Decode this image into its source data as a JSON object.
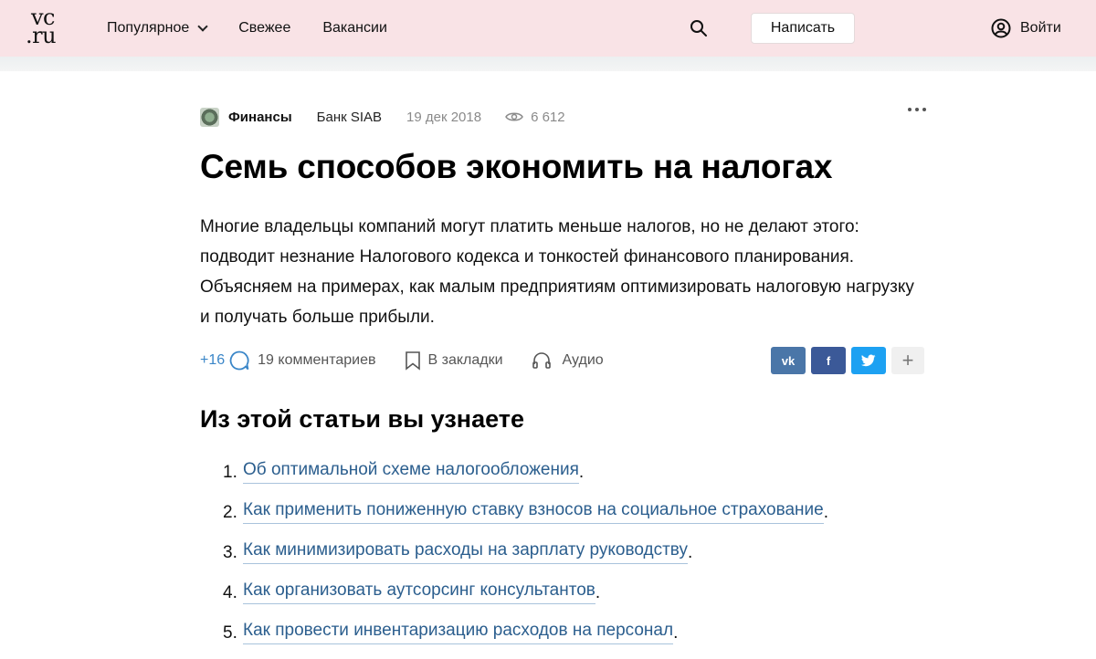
{
  "header": {
    "logo_line1": "vc",
    "logo_line2": ".ru",
    "nav": [
      {
        "label": "Популярное"
      },
      {
        "label": "Свежее"
      },
      {
        "label": "Вакансии"
      }
    ],
    "write_button": "Написать",
    "login": "Войти",
    "colors": {
      "background": "#f9e3e6"
    }
  },
  "article": {
    "category": "Финансы",
    "author": "Банк SIAB",
    "date": "19 дек 2018",
    "views": "6 612",
    "title": "Семь способов экономить на налогах",
    "lead": "Многие владельцы компаний могут платить меньше налогов, но не делают этого: подводит незнание Налогового кодекса и тонкостей финансового планирования. Объясняем на примерах, как малым предприятиям оптимизировать налоговую нагрузку и получать больше прибыли.",
    "rating": "+16",
    "comments": "19 комментариев",
    "bookmark": "В закладки",
    "audio": "Аудио",
    "share": [
      "vk",
      "f",
      "twitter",
      "+"
    ],
    "toc_title": "Из этой статьи вы узнаете",
    "toc": [
      {
        "num": "1.",
        "text": "Об оптимальной схеме налогообложения",
        "end": "."
      },
      {
        "num": "2.",
        "text": "Как применить пониженную ставку взносов на социальное страхование",
        "end": "."
      },
      {
        "num": "3.",
        "text": "Как минимизировать расходы на зарплату руководству",
        "end": "."
      },
      {
        "num": "4.",
        "text": "Как организовать аутсорсинг консультантов",
        "end": "."
      },
      {
        "num": "5.",
        "text": "Как провести инвентаризацию расходов на персонал",
        "end": "."
      }
    ]
  }
}
